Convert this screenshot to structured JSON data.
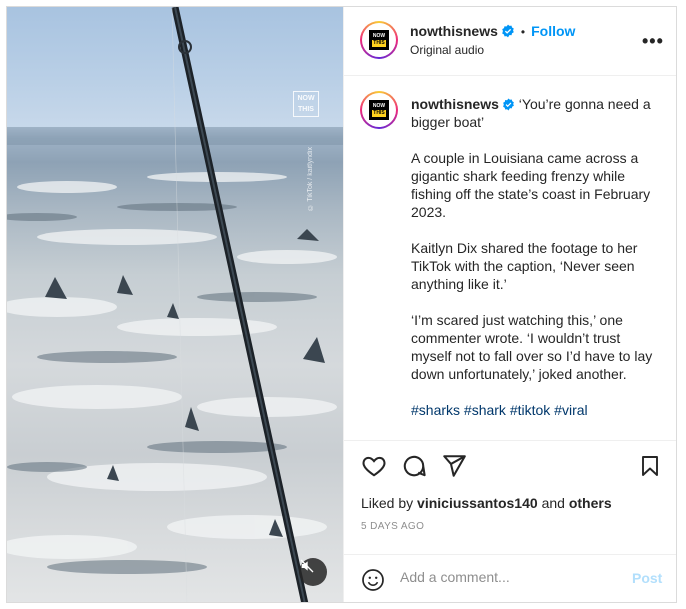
{
  "post": {
    "account": {
      "username": "nowthisnews",
      "verified": true,
      "logo_top": "NOW",
      "logo_bottom": "THIS"
    },
    "header": {
      "follow_label": "Follow",
      "separator": "•",
      "audio": "Original audio",
      "more_label": "•••"
    },
    "media": {
      "watermark_top": "NOW",
      "watermark_bottom": "THIS",
      "credit": "© TikTok / kaitlyndix",
      "muted": true
    },
    "caption": {
      "username": "nowthisnews",
      "headline": "‘You’re gonna need a bigger boat’",
      "paragraphs": [
        "A couple in Louisiana came across a gigantic shark feeding frenzy while fishing off the state’s coast in February 2023.",
        "Kaitlyn Dix shared the footage to her TikTok with the caption, ‘Never seen anything like it.’",
        "‘I’m scared just watching this,’ one commenter wrote. ‘I wouldn’t trust myself not to fall over so I’d have to lay down unfortunately,’ joked another."
      ],
      "hashtags": "#sharks #shark #tiktok #viral"
    },
    "likes": {
      "prefix": "Liked by",
      "user": "viniciussantos140",
      "joiner": "and",
      "others": "others"
    },
    "date": "5 DAYS AGO",
    "comment": {
      "placeholder": "Add a comment...",
      "post_label": "Post"
    },
    "colors": {
      "link_blue": "#0095f6",
      "hashtag": "#00376b",
      "muted_text": "#8e8e8e",
      "post_disabled": "#b2dffc"
    },
    "icons": {
      "like": "heart-icon",
      "comment": "comment-bubble-icon",
      "share": "paper-plane-icon",
      "save": "bookmark-icon",
      "emoji": "smiley-icon",
      "mute": "speaker-muted-icon",
      "verified": "verified-badge-icon"
    }
  }
}
